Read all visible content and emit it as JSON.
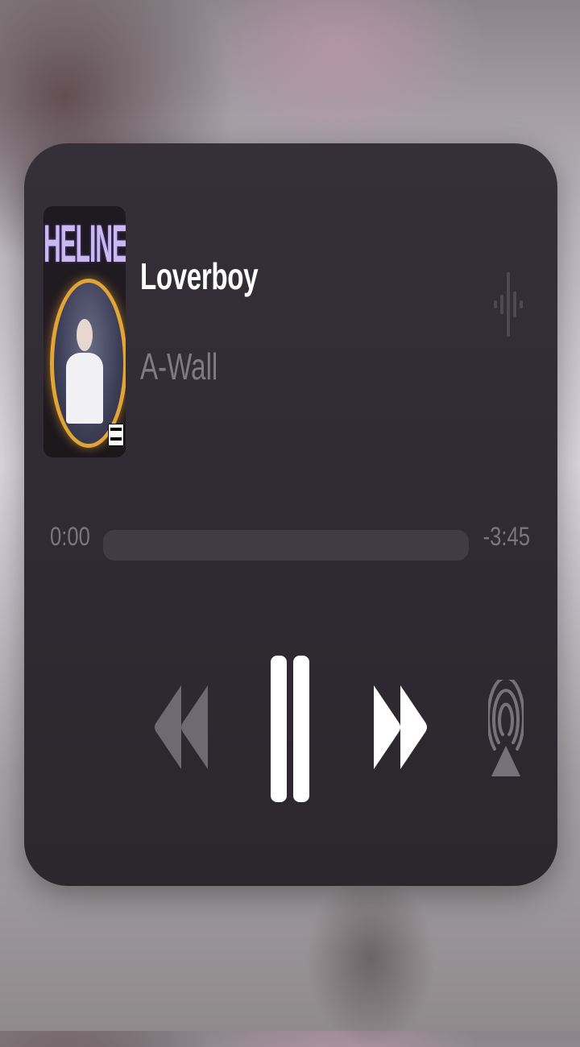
{
  "now_playing": {
    "title": "Loverboy",
    "artist": "A-Wall",
    "artwork": {
      "text": "HELINE",
      "advisory_label": "PARENTAL ADVISORY EXPLICIT CONTENT"
    }
  },
  "progress": {
    "elapsed": "0:00",
    "remaining": "-3:45",
    "fraction": 0.0
  },
  "controls": {
    "rewind_icon": "rewind-icon",
    "pause_icon": "pause-icon",
    "forward_icon": "fast-forward-icon",
    "airplay_icon": "airplay-icon",
    "waveform_icon": "waveform-icon"
  },
  "colors": {
    "card_bg": "#302b33",
    "title": "#ffffff",
    "artist": "#7f7a83",
    "track": "#403b44",
    "halo": "#e0a437"
  }
}
